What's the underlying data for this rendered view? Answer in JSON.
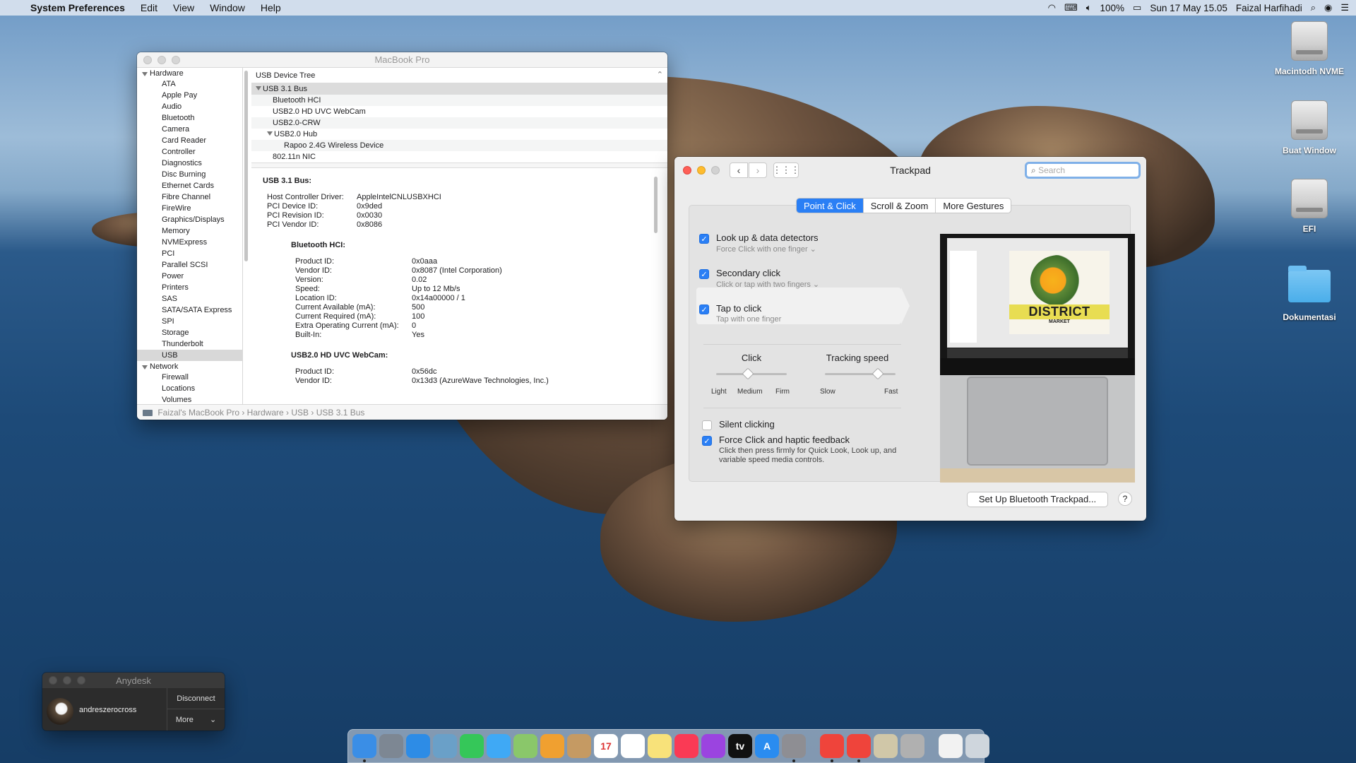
{
  "menubar": {
    "app_name": "System Preferences",
    "items": [
      "Edit",
      "View",
      "Window",
      "Help"
    ],
    "battery": "100%",
    "datetime": "Sun 17 May  15.05",
    "user": "Faizal Harfihadi"
  },
  "sysinfo": {
    "title": "MacBook Pro",
    "sidebar": {
      "hardware_label": "Hardware",
      "hardware_items": [
        "ATA",
        "Apple Pay",
        "Audio",
        "Bluetooth",
        "Camera",
        "Card Reader",
        "Controller",
        "Diagnostics",
        "Disc Burning",
        "Ethernet Cards",
        "Fibre Channel",
        "FireWire",
        "Graphics/Displays",
        "Memory",
        "NVMExpress",
        "PCI",
        "Parallel SCSI",
        "Power",
        "Printers",
        "SAS",
        "SATA/SATA Express",
        "SPI",
        "Storage",
        "Thunderbolt",
        "USB"
      ],
      "network_label": "Network",
      "network_items": [
        "Firewall",
        "Locations",
        "Volumes"
      ]
    },
    "tree_header": "USB Device Tree",
    "tree": [
      {
        "label": "USB 3.1 Bus",
        "level": 0,
        "expanded": true,
        "selected": true
      },
      {
        "label": "Bluetooth HCI",
        "level": 1
      },
      {
        "label": "USB2.0 HD UVC WebCam",
        "level": 1
      },
      {
        "label": "USB2.0-CRW",
        "level": 1
      },
      {
        "label": "USB2.0 Hub",
        "level": 1,
        "expanded": true
      },
      {
        "label": "Rapoo 2.4G Wireless Device",
        "level": 2
      },
      {
        "label": "802.11n NIC",
        "level": 1
      }
    ],
    "details": {
      "heading": "USB 3.1 Bus:",
      "bus_props": [
        {
          "k": "Host Controller Driver:",
          "v": "AppleIntelCNLUSBXHCI"
        },
        {
          "k": "PCI Device ID:",
          "v": "0x9ded"
        },
        {
          "k": "PCI Revision ID:",
          "v": "0x0030"
        },
        {
          "k": "PCI Vendor ID:",
          "v": "0x8086"
        }
      ],
      "bt_heading": "Bluetooth HCI:",
      "bt_props": [
        {
          "k": "Product ID:",
          "v": "0x0aaa"
        },
        {
          "k": "Vendor ID:",
          "v": "0x8087  (Intel Corporation)"
        },
        {
          "k": "Version:",
          "v": "0.02"
        },
        {
          "k": "Speed:",
          "v": "Up to 12 Mb/s"
        },
        {
          "k": "Location ID:",
          "v": "0x14a00000 / 1"
        },
        {
          "k": "Current Available (mA):",
          "v": "500"
        },
        {
          "k": "Current Required (mA):",
          "v": "100"
        },
        {
          "k": "Extra Operating Current (mA):",
          "v": "0"
        },
        {
          "k": "Built-In:",
          "v": "Yes"
        }
      ],
      "cam_heading": "USB2.0 HD UVC WebCam:",
      "cam_props": [
        {
          "k": "Product ID:",
          "v": "0x56dc"
        },
        {
          "k": "Vendor ID:",
          "v": "0x13d3  (AzureWave Technologies, Inc.)"
        }
      ]
    },
    "breadcrumb": "Faizal's MacBook Pro › Hardware › USB › USB 3.1 Bus"
  },
  "trackpad": {
    "title": "Trackpad",
    "search_placeholder": "Search",
    "tabs": [
      "Point & Click",
      "Scroll & Zoom",
      "More Gestures"
    ],
    "active_tab": "Point & Click",
    "options": [
      {
        "title": "Look up & data detectors",
        "sub": "Force Click with one finger ⌄",
        "checked": true
      },
      {
        "title": "Secondary click",
        "sub": "Click or tap with two fingers ⌄",
        "checked": true
      },
      {
        "title": "Tap to click",
        "sub": "Tap with one finger",
        "checked": true
      }
    ],
    "click_slider": {
      "title": "Click",
      "labels": [
        "Light",
        "Medium",
        "Firm"
      ],
      "value": "Medium"
    },
    "tracking_slider": {
      "title": "Tracking speed",
      "low": "Slow",
      "high": "Fast",
      "value": 0.75
    },
    "silent_clicking": {
      "label": "Silent clicking",
      "checked": false
    },
    "force_click": {
      "label": "Force Click and haptic feedback",
      "checked": true,
      "desc": "Click then press firmly for Quick Look, Look up, and variable speed media controls."
    },
    "preview": {
      "title": "DISTRICT",
      "subtitle": "MARKET"
    },
    "setup_button": "Set Up Bluetooth Trackpad...",
    "help": "?"
  },
  "anydesk": {
    "title": "Anydesk",
    "user": "andreszerocross",
    "disconnect": "Disconnect",
    "more": "More"
  },
  "desktop_icons": [
    "Macintodh NVME",
    "Buat Window",
    "EFI",
    "Dokumentasi"
  ],
  "dock": [
    {
      "name": "finder",
      "color": "#3a8ee6"
    },
    {
      "name": "launchpad",
      "color": "#7d8793"
    },
    {
      "name": "safari",
      "color": "#2d8ce6"
    },
    {
      "name": "preview",
      "color": "#6aa0c8"
    },
    {
      "name": "facetime",
      "color": "#35c759"
    },
    {
      "name": "messages",
      "color": "#3fa9f5"
    },
    {
      "name": "maps",
      "color": "#8ac76a"
    },
    {
      "name": "photos",
      "color": "#f0a030"
    },
    {
      "name": "contacts",
      "color": "#c59a63"
    },
    {
      "name": "calendar",
      "color": "#ffffff",
      "label": "17"
    },
    {
      "name": "reminders",
      "color": "#ffffff"
    },
    {
      "name": "notes",
      "color": "#f8e27a"
    },
    {
      "name": "music",
      "color": "#fa3a55"
    },
    {
      "name": "podcasts",
      "color": "#9b44e0"
    },
    {
      "name": "tv",
      "color": "#111111",
      "label": "tv"
    },
    {
      "name": "app-store",
      "color": "#2a8cf0",
      "label": "A"
    },
    {
      "name": "system-preferences",
      "color": "#8e8e93"
    },
    {
      "name": "anydesk",
      "color": "#ef443b"
    },
    {
      "name": "anydesk-2",
      "color": "#ef443b"
    },
    {
      "name": "script-editor",
      "color": "#d0c7a8"
    },
    {
      "name": "utility",
      "color": "#b0b0b0"
    },
    {
      "name": "document",
      "color": "#f2f2f2"
    },
    {
      "name": "trash",
      "color": "#cfd6dd"
    }
  ]
}
